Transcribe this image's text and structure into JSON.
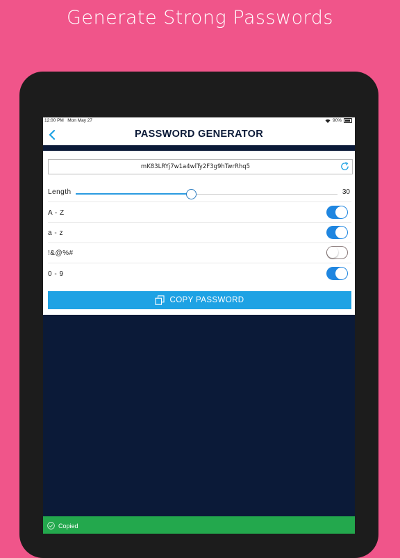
{
  "banner": "Generate Strong Passwords",
  "status": {
    "time": "12:00 PM",
    "date": "Mon May 27",
    "battery": "90%"
  },
  "nav": {
    "title": "PASSWORD GENERATOR",
    "back_icon": "chevron-left-icon"
  },
  "password": {
    "value": "mK83LRYj7w1a4wlTy2F3g9hTwrRhq5",
    "refresh_icon": "refresh-icon"
  },
  "length": {
    "label": "Length",
    "value": "30",
    "fraction": 0.44
  },
  "options": [
    {
      "label": "A - Z",
      "on": true
    },
    {
      "label": "a - z",
      "on": true
    },
    {
      "label": "!&@%#",
      "on": false
    },
    {
      "label": "0 - 9",
      "on": true
    }
  ],
  "copy_button": {
    "label": "COPY PASSWORD",
    "icon": "copy-icon"
  },
  "toast": {
    "text": "Copied",
    "icon": "check-circle-icon"
  },
  "colors": {
    "background": "#f0558a",
    "accent": "#1ea2e4",
    "toggle_on": "#1f86e0",
    "dark": "#0b1a38",
    "toast": "#23a84d"
  }
}
